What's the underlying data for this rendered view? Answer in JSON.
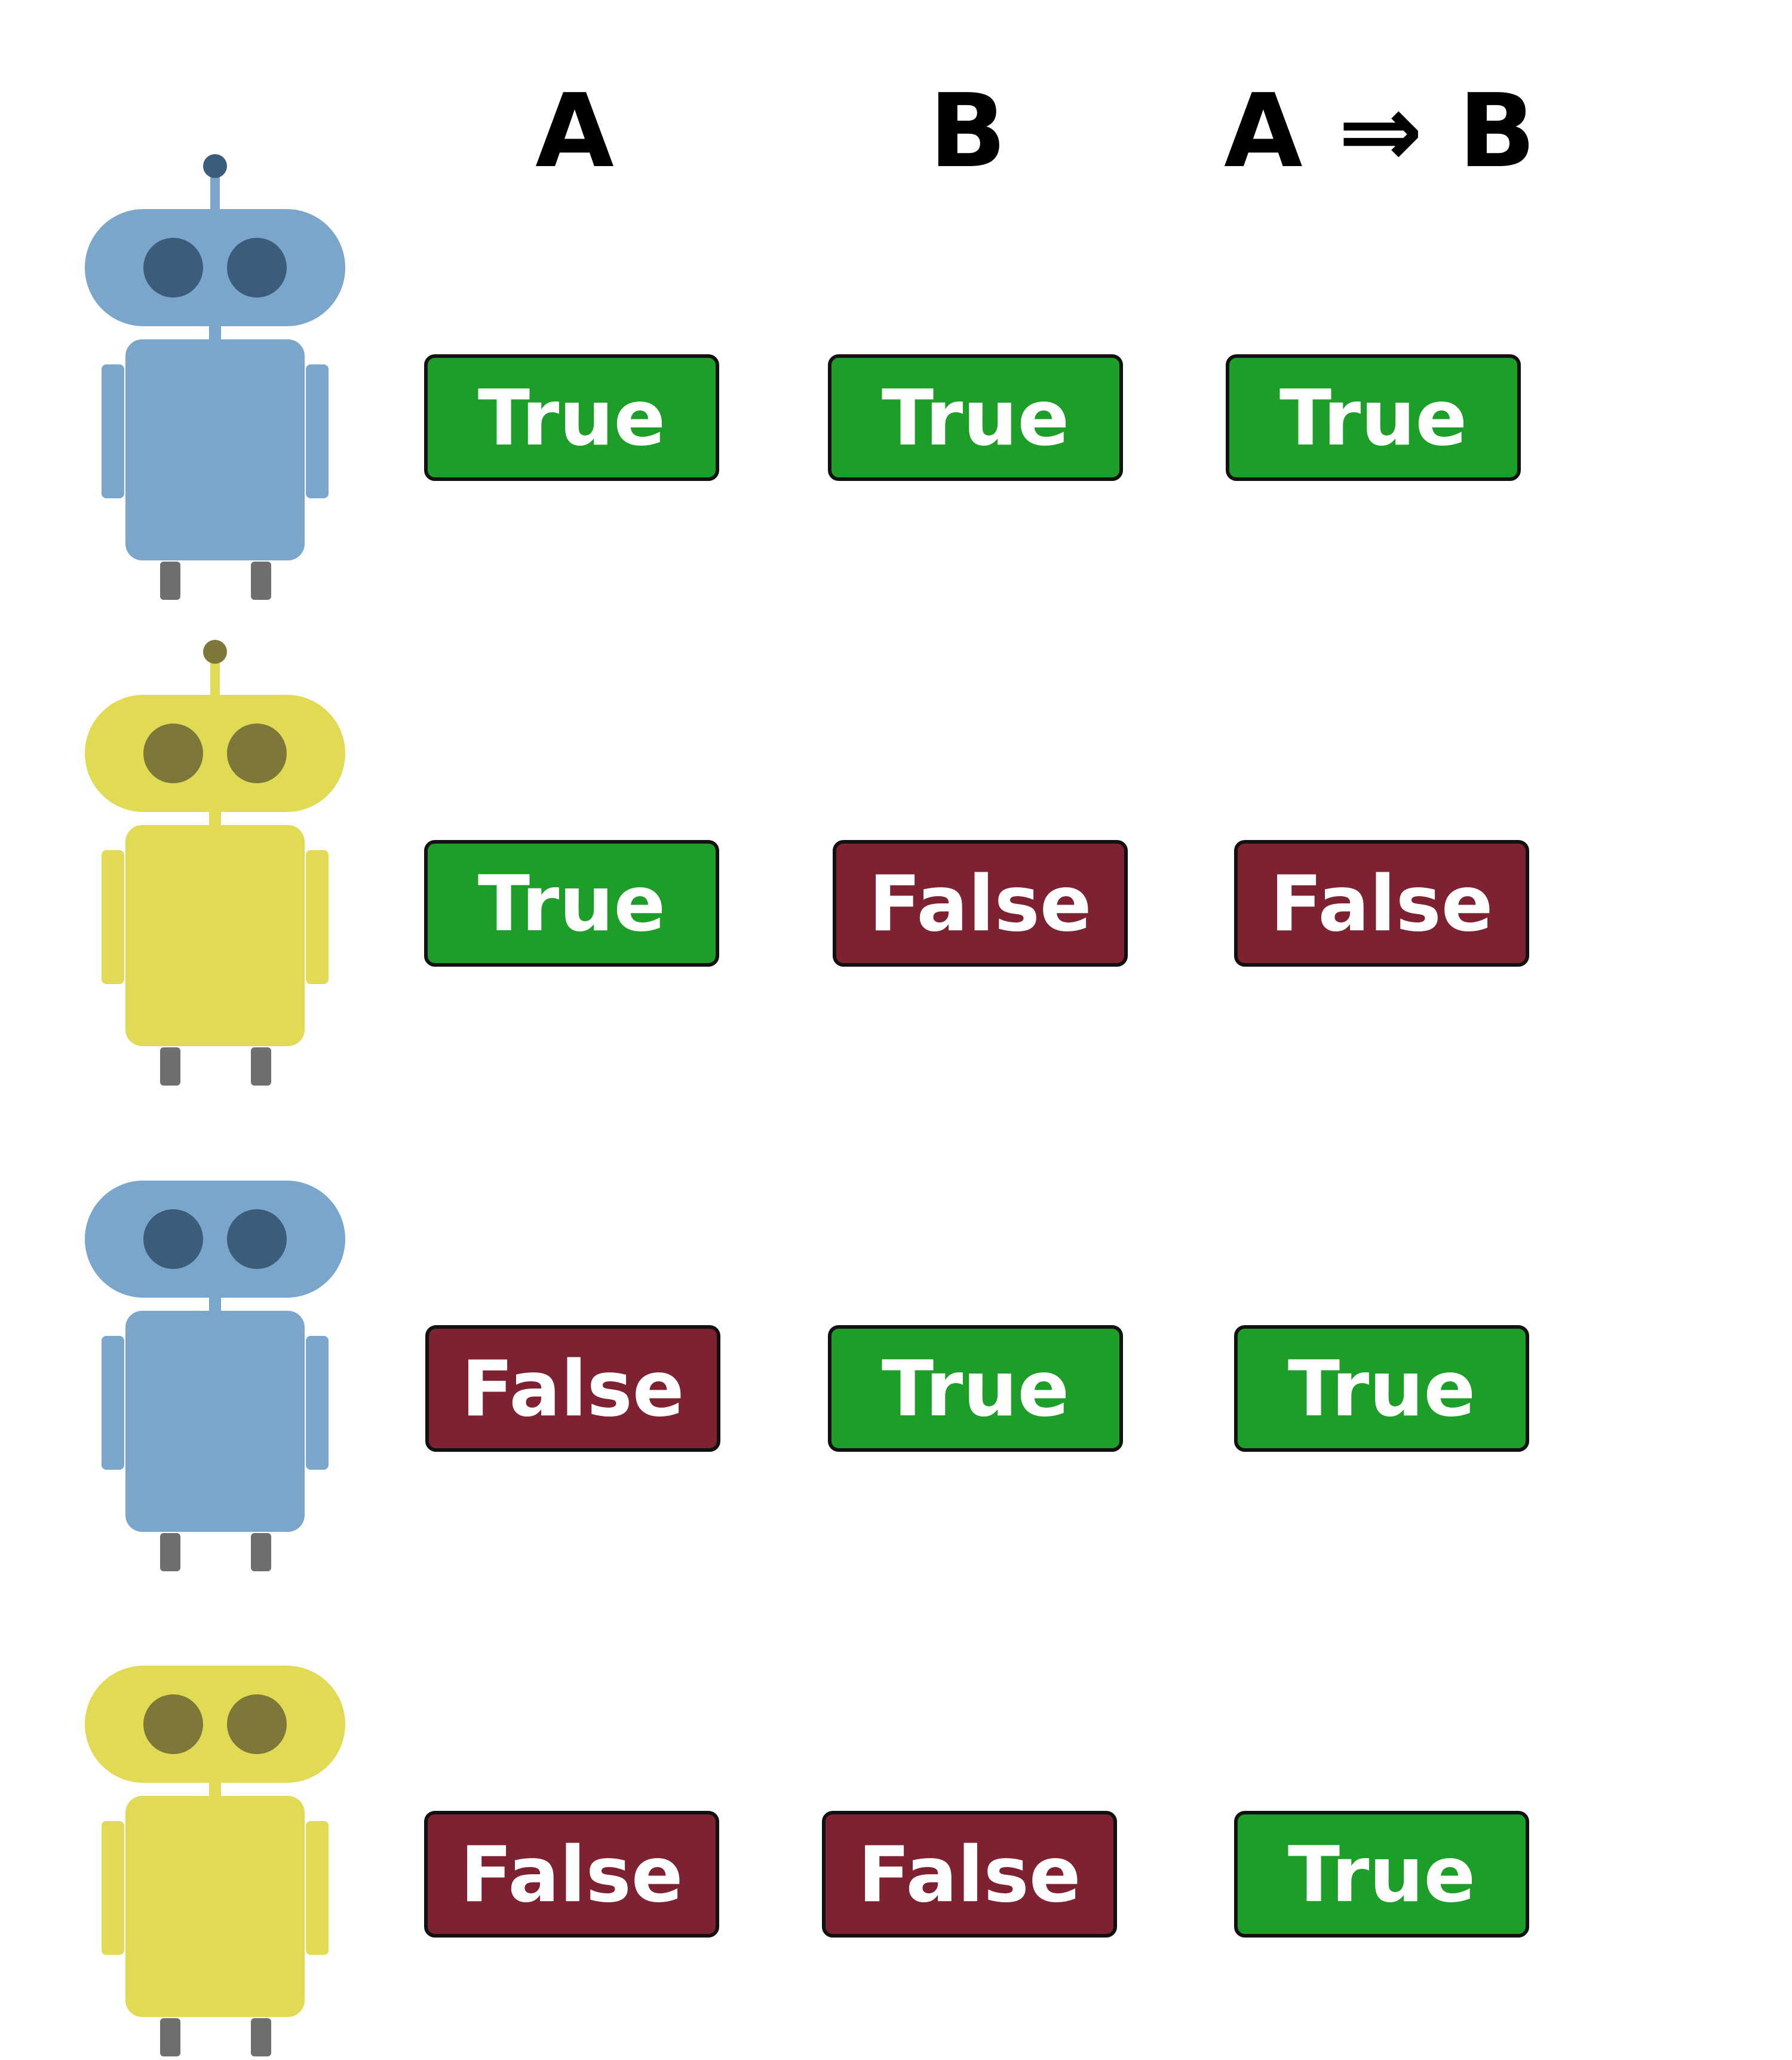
{
  "headers": {
    "a": "A",
    "b": "B",
    "implication": "A ⇒ B"
  },
  "colors": {
    "true_fill": "#1c9e28",
    "false_fill": "#7e2130",
    "border": "#111111",
    "robot_blue_body": "#7aa6cb",
    "robot_blue_eye": "#3c5c7c",
    "robot_yellow_body": "#e0da55",
    "robot_yellow_eye": "#7d783a",
    "robot_leg": "#6f6f6f"
  },
  "rows": [
    {
      "robot": {
        "color": "blue",
        "antenna": true
      },
      "a": {
        "label": "True",
        "value": true
      },
      "b": {
        "label": "True",
        "value": true
      },
      "implication": {
        "label": "True",
        "value": true
      }
    },
    {
      "robot": {
        "color": "yellow",
        "antenna": true
      },
      "a": {
        "label": "True",
        "value": true
      },
      "b": {
        "label": "False",
        "value": false
      },
      "implication": {
        "label": "False",
        "value": false
      }
    },
    {
      "robot": {
        "color": "blue",
        "antenna": false
      },
      "a": {
        "label": "False",
        "value": false
      },
      "b": {
        "label": "True",
        "value": true
      },
      "implication": {
        "label": "True",
        "value": true
      }
    },
    {
      "robot": {
        "color": "yellow",
        "antenna": false
      },
      "a": {
        "label": "False",
        "value": false
      },
      "b": {
        "label": "False",
        "value": false
      },
      "implication": {
        "label": "True",
        "value": true
      }
    }
  ]
}
